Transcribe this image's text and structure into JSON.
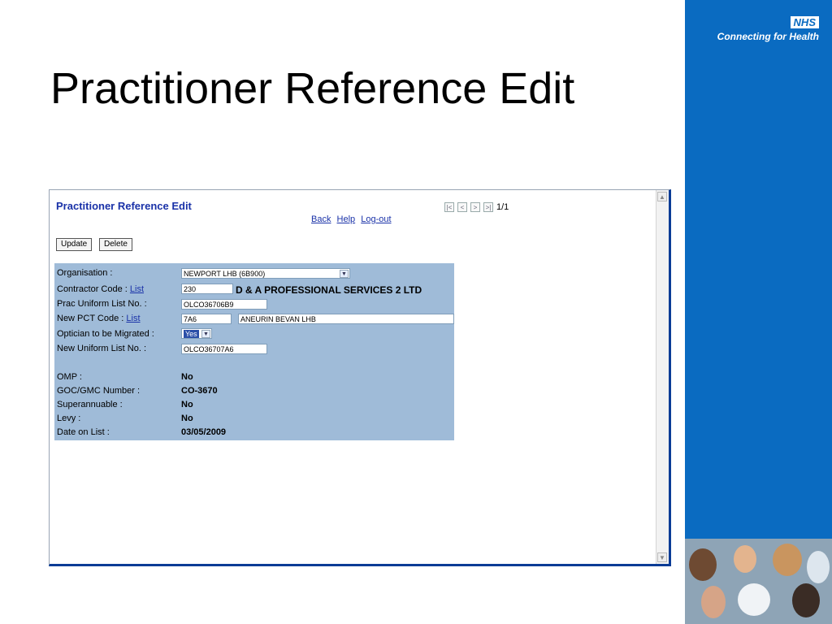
{
  "slide": {
    "title": "Practitioner Reference Edit"
  },
  "brand": {
    "logo": "NHS",
    "tagline": "Connecting for Health"
  },
  "app": {
    "title": "Practitioner Reference Edit",
    "nav": {
      "back": "Back",
      "help": "Help",
      "logout": "Log-out"
    },
    "pager": {
      "first": "|<",
      "prev": "<",
      "next": ">",
      "last": ">|",
      "count": "1/1"
    },
    "buttons": {
      "update": "Update",
      "delete": "Delete"
    }
  },
  "form": {
    "organisation": {
      "label": "Organisation :",
      "value": "NEWPORT LHB (6B900)"
    },
    "contractor": {
      "label": "Contractor Code :",
      "link": "List",
      "value": "230",
      "name": "D & A PROFESSIONAL SERVICES 2 LTD"
    },
    "prac_uniform": {
      "label": "Prac Uniform List No. :",
      "value": "OLCO36706B9"
    },
    "new_pct": {
      "label": "New PCT Code :",
      "link": "List",
      "value": "7A6",
      "name": "ANEURIN BEVAN LHB"
    },
    "optician_migrated": {
      "label": "Optician to be Migrated :",
      "value": "Yes"
    },
    "new_uniform": {
      "label": "New Uniform List No. :",
      "value": "OLCO36707A6"
    },
    "omp": {
      "label": "OMP :",
      "value": "No"
    },
    "goc_gmc": {
      "label": "GOC/GMC Number :",
      "value": "CO-3670"
    },
    "superannuable": {
      "label": "Superannuable :",
      "value": "No"
    },
    "levy": {
      "label": "Levy :",
      "value": "No"
    },
    "date_on_list": {
      "label": "Date on List :",
      "value": "03/05/2009"
    }
  },
  "colors": {
    "brand_blue": "#0a6bc1",
    "form_panel": "#9fbbd8",
    "link_blue": "#1a32a8"
  }
}
